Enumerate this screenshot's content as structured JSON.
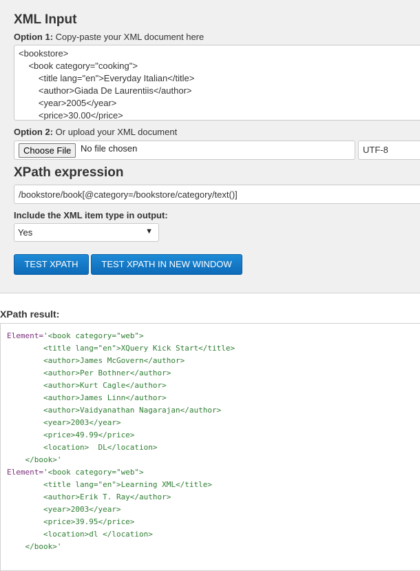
{
  "xml_input": {
    "title": "XML Input",
    "option1_bold": "Option 1:",
    "option1_text": " Copy-paste your XML document here",
    "xml_lines": [
      "<bookstore>",
      "    <book category=\"cooking\">",
      "        <title lang=\"en\">Everyday Italian</title>",
      "        <author>Giada De Laurentiis</author>",
      "        <year>2005</year>",
      "        <price>30.00</price>"
    ],
    "option2_bold": "Option 2:",
    "option2_text": " Or upload your XML document",
    "choose_file_label": "Choose File",
    "no_file_text": "No file chosen",
    "encoding_value": "UTF-8"
  },
  "xpath": {
    "title": "XPath expression",
    "expression": "/bookstore/book[@category=/bookstore/category/text()]",
    "include_type_label": "Include the XML item type in output:",
    "include_type_value": "Yes",
    "test_button": "TEST XPATH",
    "test_new_window_button": "TEST XPATH IN NEW WINDOW"
  },
  "result": {
    "label": "XPath result:",
    "items": [
      {
        "prefix": "Element=",
        "lines": [
          "'<book category=\"web\">",
          "        <title lang=\"en\">XQuery Kick Start</title>",
          "        <author>James McGovern</author>",
          "        <author>Per Bothner</author>",
          "        <author>Kurt Cagle</author>",
          "        <author>James Linn</author>",
          "        <author>Vaidyanathan Nagarajan</author>",
          "        <year>2003</year>",
          "        <price>49.99</price>",
          "        <location>  DL</location>",
          "    </book>'"
        ]
      },
      {
        "prefix": "Element=",
        "lines": [
          "'<book category=\"web\">",
          "        <title lang=\"en\">Learning XML</title>",
          "        <author>Erik T. Ray</author>",
          "        <year>2003</year>",
          "        <price>39.95</price>",
          "        <location>dl </location>",
          "    </book>'"
        ]
      }
    ]
  }
}
